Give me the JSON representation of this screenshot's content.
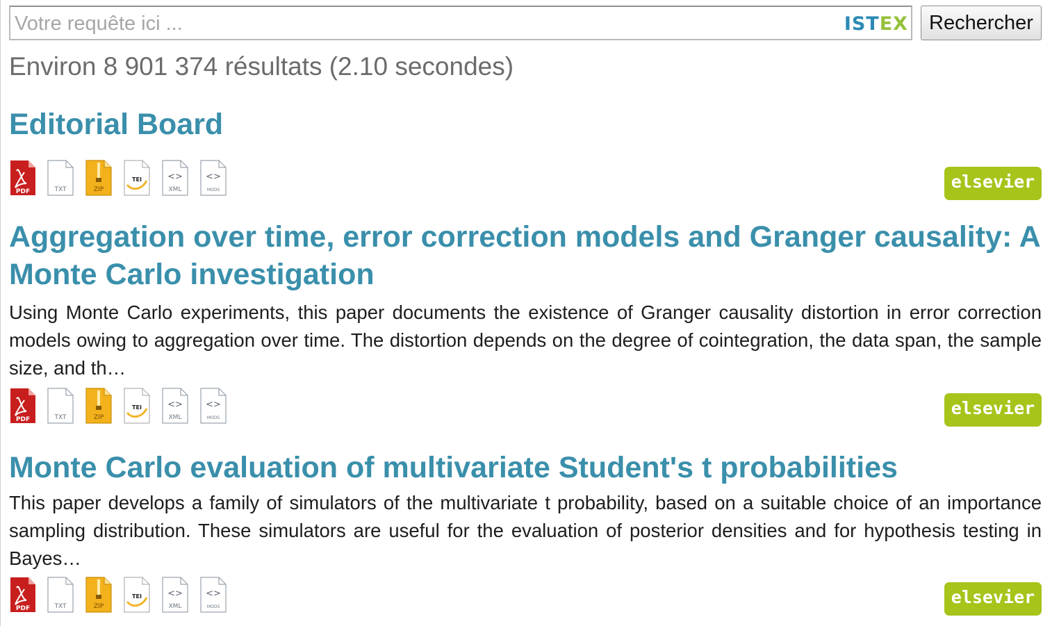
{
  "search": {
    "placeholder": "Votre requête ici ...",
    "value": "",
    "logo_part1": "IST",
    "logo_part2": "EX",
    "button_label": "Rechercher"
  },
  "results_count": "Environ 8 901 374 résultats (2.10 secondes)",
  "formats": [
    {
      "name": "pdf-icon",
      "label": "PDF"
    },
    {
      "name": "txt-icon",
      "label": "TXT"
    },
    {
      "name": "zip-icon",
      "label": "ZIP"
    },
    {
      "name": "tei-icon",
      "label": "TEI"
    },
    {
      "name": "xml-icon",
      "label": "XML"
    },
    {
      "name": "mods-icon",
      "label": "MODS"
    }
  ],
  "results": [
    {
      "title": "Editorial Board",
      "abstract": "",
      "publisher": "elsevier"
    },
    {
      "title": "Aggregation over time, error correction models and Granger causality: A Monte Carlo investigation",
      "abstract": "Using Monte Carlo experiments, this paper documents the existence of Granger causality distortion in error correction models owing to aggregation over time. The distortion depends on the degree of cointegration, the data span, the sample size, and th…",
      "publisher": "elsevier"
    },
    {
      "title": "Monte Carlo evaluation of multivariate Student's t probabilities",
      "abstract": "This paper develops a family of simulators of the multivariate t probability, based on a suitable choice of an importance sampling distribution. These simulators are useful for the evaluation of posterior densities and for hypothesis testing in Bayes…",
      "publisher": "elsevier"
    }
  ],
  "colors": {
    "title_link": "#3a8fab",
    "publisher_badge": "#a6c41a",
    "pdf_red": "#c81e1e",
    "zip_yellow": "#f3b21c",
    "logo_blue": "#2b8ab4",
    "logo_green": "#96c13c"
  }
}
